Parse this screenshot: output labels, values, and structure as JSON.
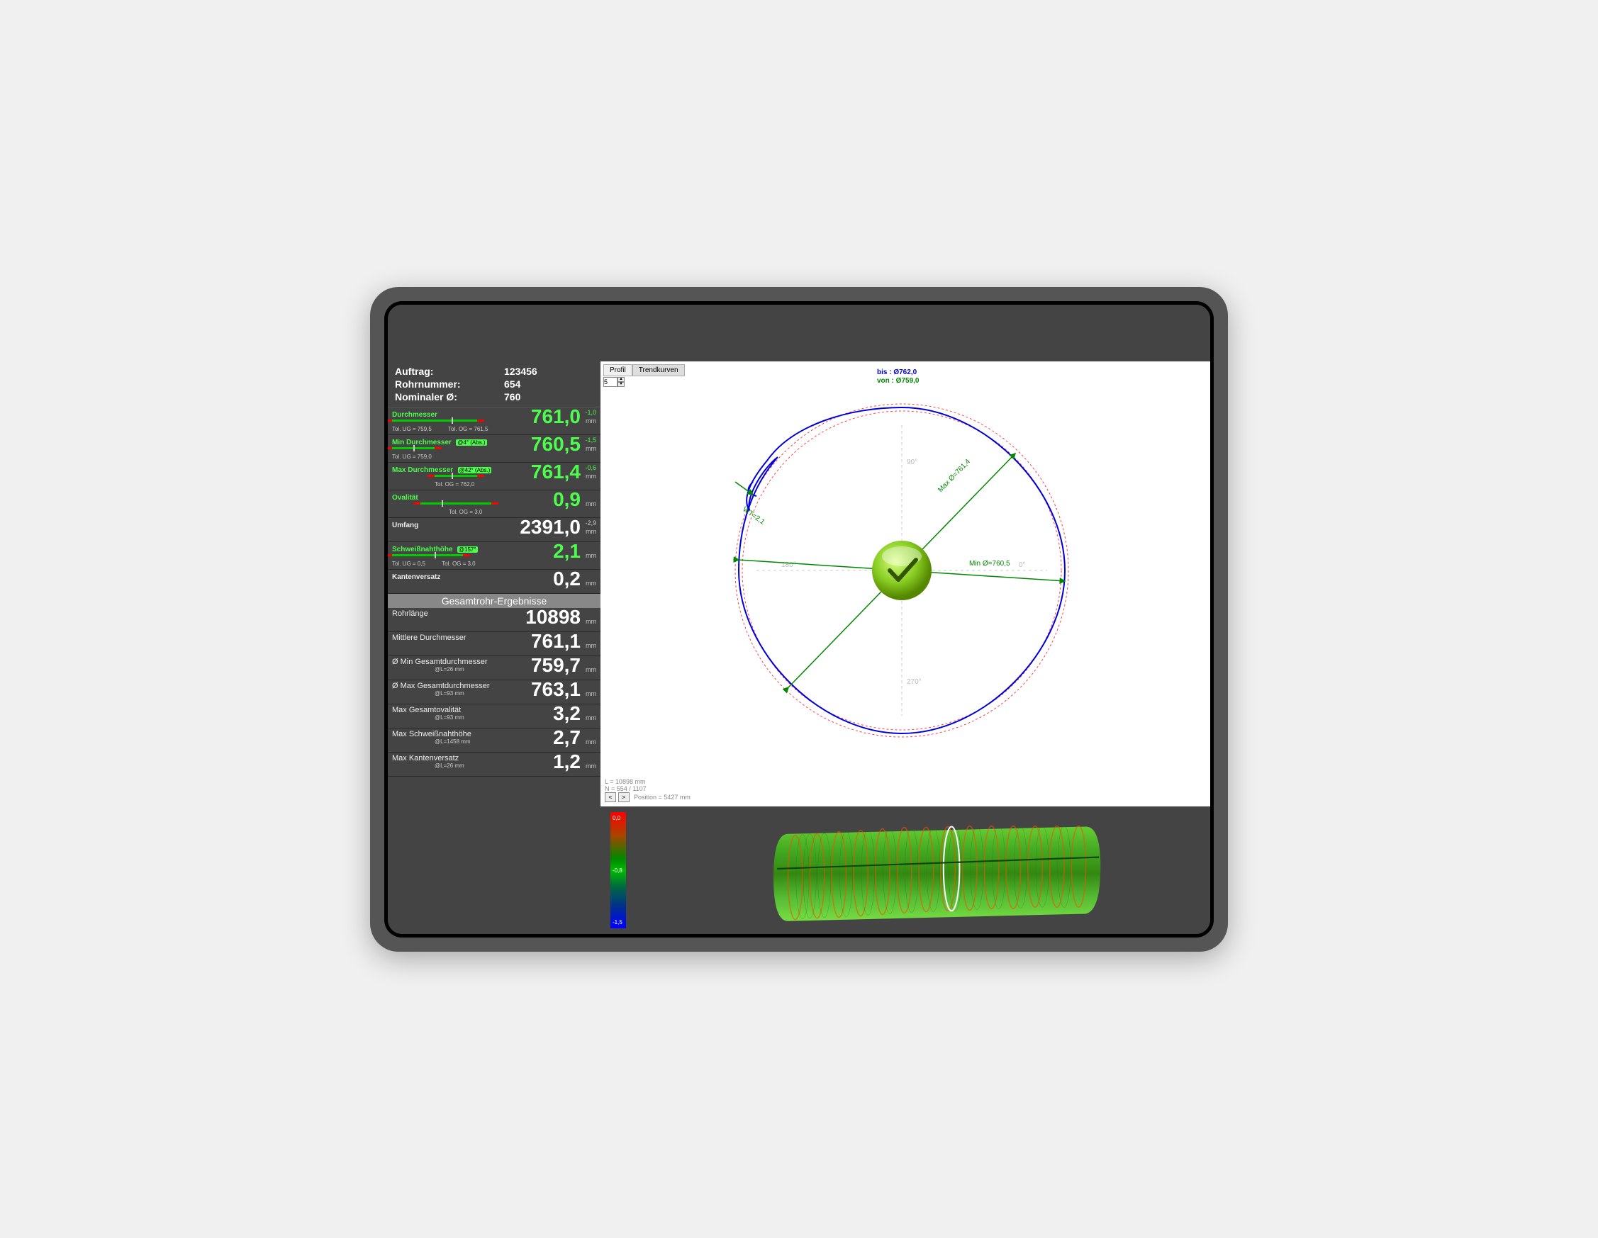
{
  "header": {
    "auftrag_label": "Auftrag:",
    "auftrag_value": "123456",
    "rohrnummer_label": "Rohrnummer:",
    "rohrnummer_value": "654",
    "nominal_label": "Nominaler Ø:",
    "nominal_value": "760"
  },
  "metrics": {
    "durchmesser": {
      "label": "Durchmesser",
      "tol_ug": "Tol. UG = 759,5",
      "tol_og": "Tol. OG = 761,5",
      "value": "761,0",
      "dev": "-1,0",
      "unit": "mm"
    },
    "min_d": {
      "label": "Min Durchmesser",
      "angle": "@4° (Abs.)",
      "tol_ug": "Tol. UG = 759,0",
      "value": "760,5",
      "dev": "-1,5",
      "unit": "mm"
    },
    "max_d": {
      "label": "Max Durchmesser",
      "angle": "@42° (Abs.)",
      "tol_og": "Tol. OG = 762,0",
      "value": "761,4",
      "dev": "-0,6",
      "unit": "mm"
    },
    "oval": {
      "label": "Ovalität",
      "tol_og": "Tol. OG = 3,0",
      "value": "0,9",
      "unit": "mm"
    },
    "umfang": {
      "label": "Umfang",
      "value": "2391,0",
      "dev": "-2,9",
      "unit": "mm"
    },
    "schweiss": {
      "label": "Schweißnahthöhe",
      "angle": "@157°",
      "tol_ug": "Tol. UG = 0,5",
      "tol_og": "Tol. OG = 3,0",
      "value": "2,1",
      "unit": "mm"
    },
    "kanten": {
      "label": "Kantenversatz",
      "value": "0,2",
      "unit": "mm"
    }
  },
  "results_header": "Gesamtrohr-Ergebnisse",
  "results": {
    "rohrlaenge": {
      "label": "Rohrlänge",
      "value": "10898",
      "unit": "mm"
    },
    "mittl_d": {
      "label": "Mittlere Durchmesser",
      "value": "761,1",
      "unit": "mm"
    },
    "min_g": {
      "label": "Ø Min Gesamtdurchmesser",
      "sub": "@L=26 mm",
      "value": "759,7",
      "unit": "mm"
    },
    "max_g": {
      "label": "Ø Max Gesamtdurchmesser",
      "sub": "@L=93 mm",
      "value": "763,1",
      "unit": "mm"
    },
    "max_oval": {
      "label": "Max Gesamtovalität",
      "sub": "@L=93 mm",
      "value": "3,2",
      "unit": "mm"
    },
    "max_schweiss": {
      "label": "Max Schweißnahthöhe",
      "sub": "@L=1458 mm",
      "value": "2,7",
      "unit": "mm"
    },
    "max_kanten": {
      "label": "Max Kantenversatz",
      "sub": "@L=26 mm",
      "value": "1,2",
      "unit": "mm"
    }
  },
  "tabs": {
    "profil": "Profil",
    "trend": "Trendkurven"
  },
  "spinner_value": "5",
  "circle": {
    "bis": "bis : Ø762,0",
    "von": "von : Ø759,0",
    "wt": "WT=2,1",
    "max": "Max Ø=761,4",
    "min": "Min Ø=760,5",
    "deg90": "90°",
    "deg180": "180°",
    "deg270": "270°",
    "deg0": "0°"
  },
  "status": {
    "l": "L = 10898 mm",
    "n": "N = 554 / 1107",
    "pos": "Position = 5427 mm"
  },
  "legend": {
    "t": "0,0",
    "m": "-0,8",
    "b": "-1,5"
  }
}
